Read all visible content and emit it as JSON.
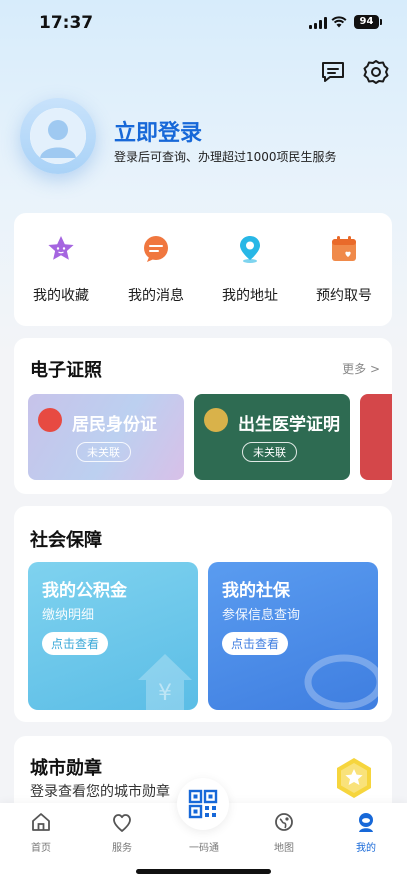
{
  "status_bar": {
    "time": "17:37",
    "battery": "94"
  },
  "header": {
    "login_title": "立即登录",
    "login_subtitle": "登录后可查询、办理超过1000项民生服务"
  },
  "quick_actions": [
    {
      "label": "我的收藏",
      "icon": "star-icon"
    },
    {
      "label": "我的消息",
      "icon": "message-icon"
    },
    {
      "label": "我的地址",
      "icon": "location-pin-icon"
    },
    {
      "label": "预约取号",
      "icon": "calendar-icon"
    }
  ],
  "id_section": {
    "title": "电子证照",
    "more": "更多 >",
    "cards": [
      {
        "title": "居民身份证",
        "badge": "未关联"
      },
      {
        "title": "出生医学证明",
        "badge": "未关联"
      }
    ]
  },
  "social_section": {
    "title": "社会保障",
    "cards": [
      {
        "title": "我的公积金",
        "subtitle": "缴纳明细",
        "button": "点击查看"
      },
      {
        "title": "我的社保",
        "subtitle": "参保信息查询",
        "button": "点击查看"
      }
    ]
  },
  "city_badge": {
    "title": "城市勋章",
    "subtitle": "登录查看您的城市勋章"
  },
  "tabbar": [
    {
      "label": "首页"
    },
    {
      "label": "服务"
    },
    {
      "label": "一码通"
    },
    {
      "label": "地图"
    },
    {
      "label": "我的"
    }
  ],
  "colors": {
    "accent": "#1768d8",
    "id_card_blue": "#b9c9f0",
    "birth_cert_green": "#2e6b52",
    "fund_card": "#6cc7e8",
    "social_card": "#4f8ee8"
  }
}
